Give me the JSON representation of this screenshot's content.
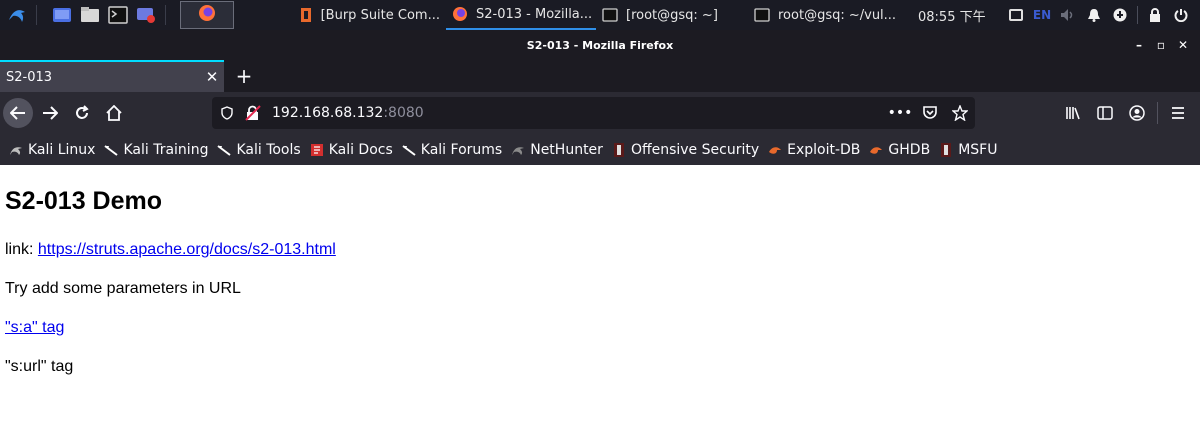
{
  "taskbar": {
    "tasks": [
      {
        "label": "[Burp Suite Com...",
        "icon": "burp-icon"
      },
      {
        "label": "S2-013 - Mozilla...",
        "icon": "firefox-icon",
        "active": true
      },
      {
        "label": "[root@gsq: ~]",
        "icon": "terminal-icon"
      },
      {
        "label": "root@gsq: ~/vul...",
        "icon": "terminal-icon"
      }
    ],
    "clock": "08:55 下午",
    "language": "EN"
  },
  "window": {
    "title": "S2-013 - Mozilla Firefox",
    "controls": {
      "minimize": "–",
      "maximize": "▫",
      "close": "✕"
    }
  },
  "tabs": [
    {
      "title": "S2-013",
      "close": "✕"
    }
  ],
  "newtab_label": "+",
  "urlbar": {
    "host": "192.168.68.132",
    "port": ":8080",
    "actions": "•••"
  },
  "bookmarks": [
    {
      "label": "Kali Linux",
      "icon": "kali-icon"
    },
    {
      "label": "Kali Training",
      "icon": "kali-icon"
    },
    {
      "label": "Kali Tools",
      "icon": "kali-icon"
    },
    {
      "label": "Kali Docs",
      "icon": "kali-docs-icon"
    },
    {
      "label": "Kali Forums",
      "icon": "kali-icon"
    },
    {
      "label": "NetHunter",
      "icon": "nethunter-icon"
    },
    {
      "label": "Offensive Security",
      "icon": "offsec-icon"
    },
    {
      "label": "Exploit-DB",
      "icon": "exploitdb-icon"
    },
    {
      "label": "GHDB",
      "icon": "ghdb-icon"
    },
    {
      "label": "MSFU",
      "icon": "offsec-icon"
    }
  ],
  "page": {
    "heading": "S2-013 Demo",
    "link_prefix": "link: ",
    "link_url": "https://struts.apache.org/docs/s2-013.html",
    "hint": "Try add some parameters in URL",
    "sa_tag": "\"s:a\" tag",
    "surl_tag": "\"s:url\" tag"
  },
  "colors": {
    "taskbar_bg": "#1a1b24",
    "chrome_bg": "#2b2a33",
    "tab_active_bg": "#42414d",
    "tab_accent": "#00ddff",
    "link": "#0000ee"
  }
}
